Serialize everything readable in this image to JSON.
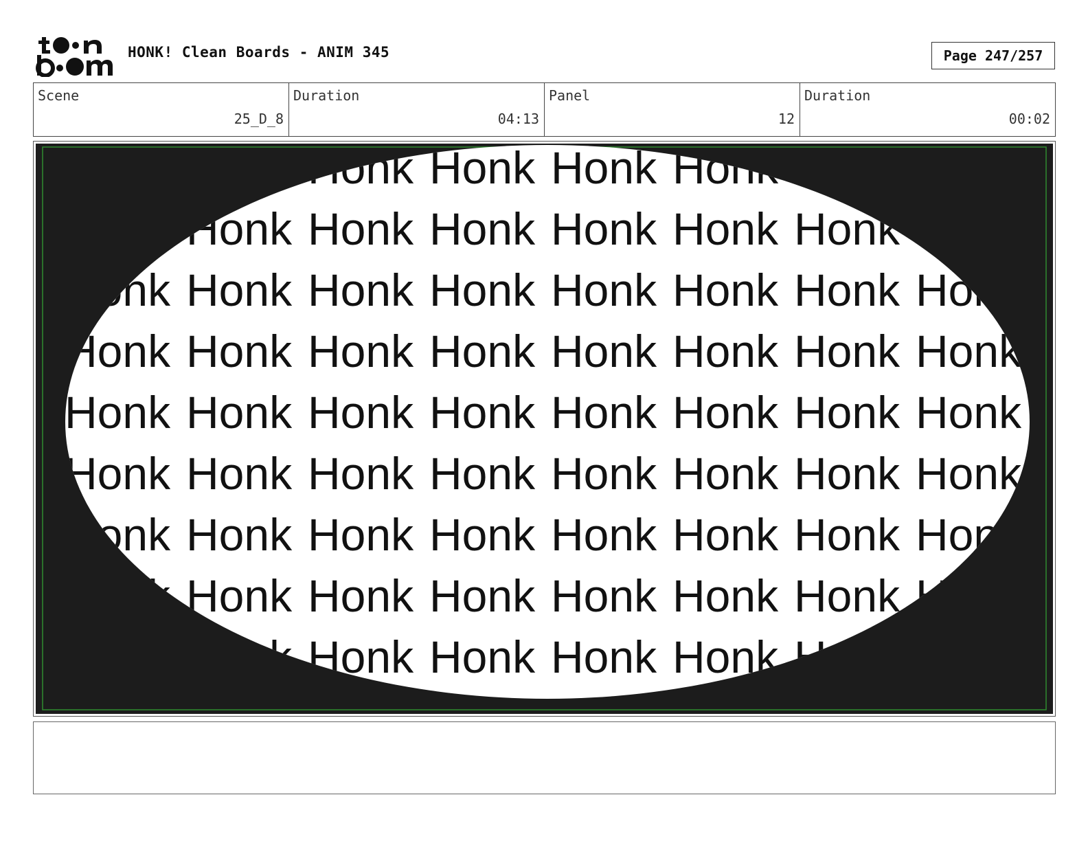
{
  "header": {
    "logo_text": "toon boom",
    "title": "HONK! Clean Boards - ANIM 345",
    "page_label": "Page 247/257"
  },
  "info": {
    "scene_label": "Scene",
    "scene_value": "25_D_8",
    "scene_duration_label": "Duration",
    "scene_duration_value": "04:13",
    "panel_label": "Panel",
    "panel_value": "12",
    "panel_duration_label": "Duration",
    "panel_duration_value": "00:02"
  },
  "panel": {
    "repeated_word": "Honk",
    "background_color": "#1c1c1c",
    "safe_area_color": "#2e8b2e",
    "ellipse_color": "#ffffff",
    "text_color": "#111111"
  },
  "notes": {
    "text": ""
  }
}
